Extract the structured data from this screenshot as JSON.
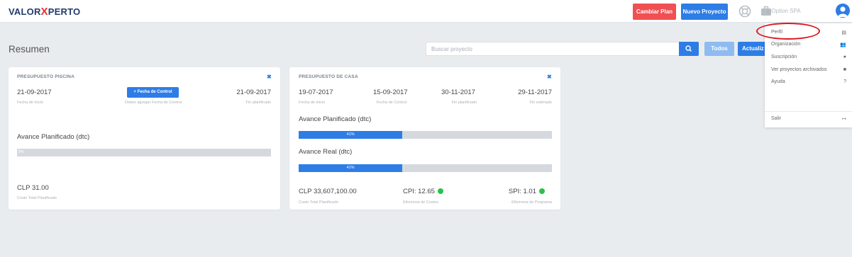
{
  "navbar": {
    "logo_left": "VALOR",
    "logo_x": "X",
    "logo_right": "PERTO",
    "btn_cambiar": "Cambiar Plan",
    "btn_nuevo": "Nuevo Proyecto",
    "company": "Option SPA",
    "colors": {
      "red": "#f05052",
      "blue": "#2e7de6"
    }
  },
  "toolbar": {
    "title": "Resumen",
    "search_placeholder": "Buscar proyecto",
    "btn_todos": "Todos",
    "btn_actualizar": "Actualiz"
  },
  "card1": {
    "title": "PRESUPUESTO PISCINA",
    "start_date": "21-09-2017",
    "start_label": "Fecha de inicio",
    "control_button": "+ Fecha de Control",
    "control_label": "Debes agregar Fecha de Control",
    "end_date": "21-09-2017",
    "end_label": "Fin planificado",
    "planned_title": "Avance Planificado (dtc)",
    "planned_percent": "0%",
    "planned_progress": 0,
    "cost": "CLP 31.00",
    "cost_label": "Costo Total Planificado"
  },
  "card2": {
    "title": "PRESUPUESTO DE CASA",
    "dates": [
      {
        "value": "19-07-2017",
        "label": "Fecha de inicio"
      },
      {
        "value": "15-09-2017",
        "label": "Fecha de Control"
      },
      {
        "value": "30-11-2017",
        "label": "Fin planificado"
      },
      {
        "value": "29-11-2017",
        "label": "Fin estimado"
      }
    ],
    "planned_title": "Avance Planificado (dtc)",
    "planned_percent": "41%",
    "planned_progress": 0.41,
    "real_title": "Avance Real (dtc)",
    "real_percent": "41%",
    "real_progress": 0.41,
    "cost": "CLP 33,607,100.00",
    "cost_label": "Costo Total Planificado",
    "cpi": "CPI: 12.65",
    "cpi_label": "Eficiencia de Costos",
    "spi": "SPI: 1.01",
    "spi_label": "Eficiencia de Programa",
    "status_color": "#27c24c"
  },
  "dropdown": {
    "items": [
      {
        "label": "Perfil",
        "icon": "id-card-icon",
        "glyph": "▤"
      },
      {
        "label": "Organización",
        "icon": "users-icon",
        "glyph": "👥"
      },
      {
        "label": "Suscripción",
        "icon": "user-icon",
        "glyph": "●"
      },
      {
        "label": "Ver proyectos archivados",
        "icon": "archive-icon",
        "glyph": "■"
      },
      {
        "label": "Ayuda",
        "icon": "help-icon",
        "glyph": "?"
      },
      {
        "label": "Salir",
        "icon": "sign-out-icon",
        "glyph": "↦"
      }
    ]
  }
}
